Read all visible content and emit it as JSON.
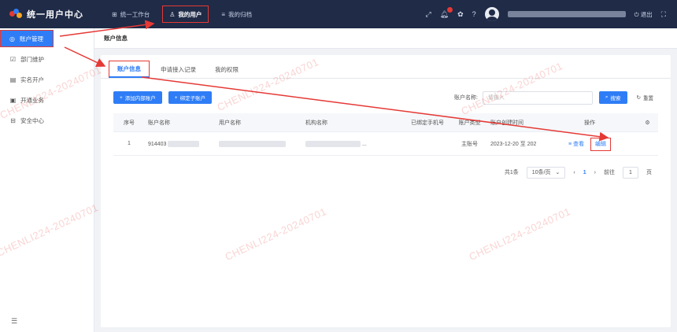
{
  "app": {
    "title": "统一用户中心"
  },
  "topnav": [
    {
      "label": "统一工作台",
      "icon": "grid-icon",
      "active": false
    },
    {
      "label": "我的用户",
      "icon": "user-icon",
      "active": true
    },
    {
      "label": "我的归档",
      "icon": "list-icon",
      "active": false
    }
  ],
  "topright": {
    "logout_label": "退出"
  },
  "sidebar": {
    "items": [
      {
        "label": "账户管理",
        "active": true
      },
      {
        "label": "部门维护",
        "active": false
      },
      {
        "label": "实名开户",
        "active": false
      },
      {
        "label": "开通业务",
        "active": false
      },
      {
        "label": "安全中心",
        "active": false
      }
    ]
  },
  "page": {
    "title": "账户信息"
  },
  "tabs": [
    {
      "label": "账户信息",
      "active": true
    },
    {
      "label": "申请接入记录",
      "active": false
    },
    {
      "label": "我的权限",
      "active": false
    }
  ],
  "toolbar": {
    "add_label": "添加内部账户",
    "sub_label": "绑定子账户",
    "search_label": "账户名称:",
    "search_placeholder": "请输入",
    "search_button": "搜索",
    "reset_button": "重置"
  },
  "table": {
    "headers": [
      "序号",
      "账户名称",
      "用户名称",
      "机构名称",
      "已绑定手机号",
      "账户类型",
      "账户创建时间",
      "操作"
    ],
    "rows": [
      {
        "index": "1",
        "account_prefix": "914403",
        "name": "",
        "org_suffix": "...",
        "phone": "",
        "type": "主账号",
        "created": "2023-12-20 至 202",
        "view": "查看",
        "edit": "编辑"
      }
    ]
  },
  "pager": {
    "total": "共1条",
    "page_size": "10条/页",
    "current": "1",
    "goto_label": "前往",
    "goto_value": "1",
    "page_unit": "页"
  },
  "watermark": "CHENLI224-20240701",
  "colors": {
    "topbar": "#1f2b47",
    "accent": "#2f7df6",
    "annotation": "#e53935"
  }
}
